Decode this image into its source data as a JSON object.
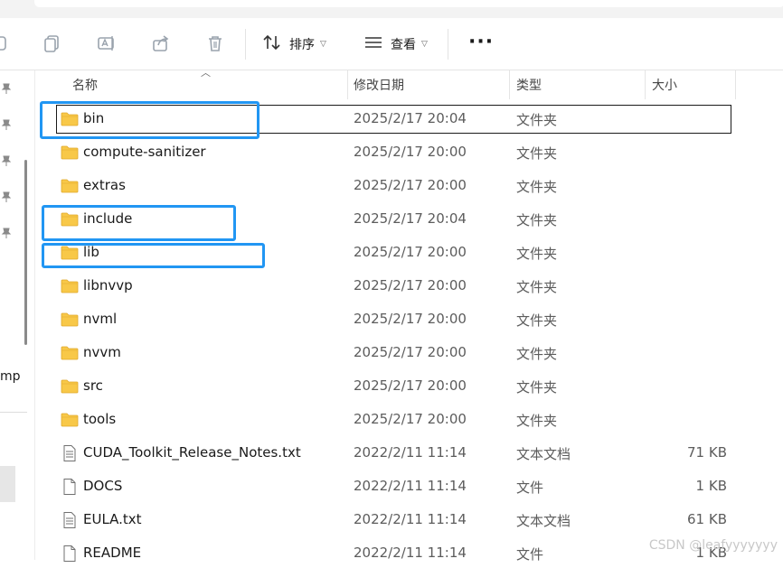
{
  "toolbar": {
    "sort_label": "排序",
    "view_label": "查看",
    "more_label": "···"
  },
  "nav": {
    "partial_text": "mp"
  },
  "columns": {
    "name": "名称",
    "date": "修改日期",
    "type": "类型",
    "size": "大小"
  },
  "files": [
    {
      "name": "bin",
      "date": "2025/2/17 20:04",
      "type": "文件夹",
      "size": "",
      "icon": "folder-icon"
    },
    {
      "name": "compute-sanitizer",
      "date": "2025/2/17 20:00",
      "type": "文件夹",
      "size": "",
      "icon": "folder-icon"
    },
    {
      "name": "extras",
      "date": "2025/2/17 20:00",
      "type": "文件夹",
      "size": "",
      "icon": "folder-icon"
    },
    {
      "name": "include",
      "date": "2025/2/17 20:04",
      "type": "文件夹",
      "size": "",
      "icon": "folder-icon"
    },
    {
      "name": "lib",
      "date": "2025/2/17 20:00",
      "type": "文件夹",
      "size": "",
      "icon": "folder-icon"
    },
    {
      "name": "libnvvp",
      "date": "2025/2/17 20:00",
      "type": "文件夹",
      "size": "",
      "icon": "folder-icon"
    },
    {
      "name": "nvml",
      "date": "2025/2/17 20:00",
      "type": "文件夹",
      "size": "",
      "icon": "folder-icon"
    },
    {
      "name": "nvvm",
      "date": "2025/2/17 20:00",
      "type": "文件夹",
      "size": "",
      "icon": "folder-icon"
    },
    {
      "name": "src",
      "date": "2025/2/17 20:00",
      "type": "文件夹",
      "size": "",
      "icon": "folder-icon"
    },
    {
      "name": "tools",
      "date": "2025/2/17 20:00",
      "type": "文件夹",
      "size": "",
      "icon": "folder-icon"
    },
    {
      "name": "CUDA_Toolkit_Release_Notes.txt",
      "date": "2022/2/11 11:14",
      "type": "文本文档",
      "size": "71 KB",
      "icon": "text-file-icon"
    },
    {
      "name": "DOCS",
      "date": "2022/2/11 11:14",
      "type": "文件",
      "size": "1 KB",
      "icon": "file-icon"
    },
    {
      "name": "EULA.txt",
      "date": "2022/2/11 11:14",
      "type": "文本文档",
      "size": "61 KB",
      "icon": "text-file-icon"
    },
    {
      "name": "README",
      "date": "2022/2/11 11:14",
      "type": "文件",
      "size": "1 KB",
      "icon": "file-icon"
    }
  ],
  "watermark": "CSDN @leafyyyyyyy",
  "colors": {
    "folder": "#f8c848",
    "highlight": "#2196f3",
    "focus_outline": "#1a1a1a"
  }
}
